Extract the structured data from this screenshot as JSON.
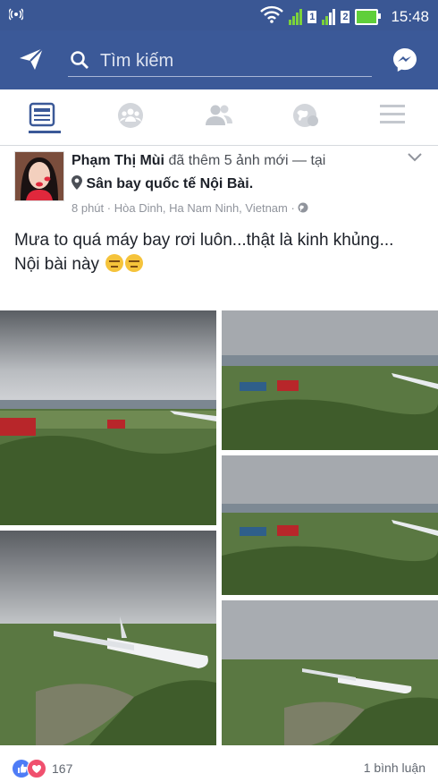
{
  "status_bar": {
    "signal_box_1": "1",
    "signal_box_2": "2",
    "time": "15:48"
  },
  "app_bar": {
    "search_placeholder": "Tìm kiếm"
  },
  "icons": {
    "status": [
      "notification-icon",
      "wifi-icon",
      "signal-icon",
      "battery-icon"
    ],
    "app_bar": [
      "send-icon",
      "search-icon",
      "messenger-icon"
    ],
    "tabs": [
      "news-feed-icon",
      "groups-icon",
      "friends-icon",
      "notifications-globe-icon",
      "menu-icon"
    ]
  },
  "post": {
    "author": "Phạm Thị Mùi",
    "action": "đã thêm 5 ảnh mới — tại",
    "place": "Sân bay quốc tế Nội Bài.",
    "time": "8 phút",
    "location": "Hòa Dinh, Ha Nam Ninh, Vietnam",
    "text_line1": "Mưa to quá máy bay rơi luôn...thật là kinh khủng...",
    "text_line2": "Nội bài này",
    "reaction_count": "167",
    "comments": "1 bình luận"
  },
  "colors": {
    "facebook_blue": "#3b5998",
    "status_bar": "#3a5794",
    "like_blue": "#4e7cf6",
    "love_red": "#f0506e"
  }
}
